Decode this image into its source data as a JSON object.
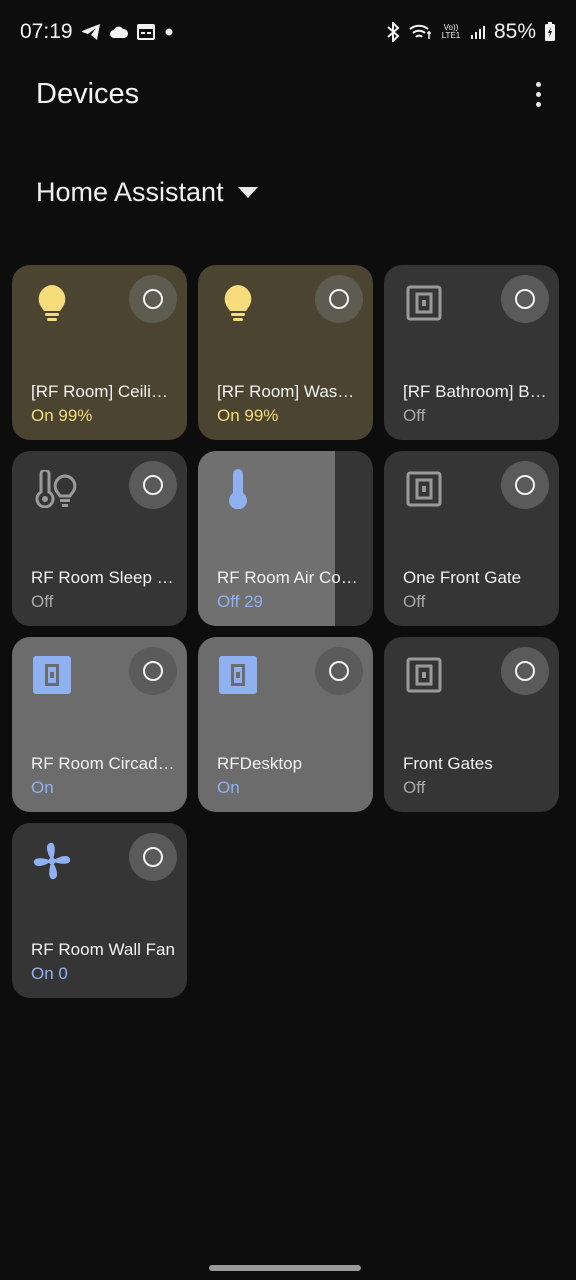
{
  "status_bar": {
    "time": "07:19",
    "battery": "85%",
    "left_icons": [
      "telegram-icon",
      "cloud-icon",
      "calendar-icon",
      "dot-icon"
    ],
    "right_icons": [
      "bluetooth-icon",
      "wifi-icon",
      "volte-icon",
      "signal-icon",
      "battery-icon"
    ],
    "volte_label": "Vo)) LTE1"
  },
  "header": {
    "title": "Devices",
    "menu_icon": "more-vert-icon"
  },
  "selector": {
    "label": "Home Assistant"
  },
  "colors": {
    "on_yellow": "#f7dc7c",
    "on_blue": "#8fb1f1",
    "off_gray": "#a9a9a9"
  },
  "tiles": [
    {
      "name": "[RF Room] Ceilin…",
      "state": "On 99%",
      "icon": "lightbulb-icon"
    },
    {
      "name": "[RF Room] Wash…",
      "state": "On 99%",
      "icon": "lightbulb-icon"
    },
    {
      "name": "[RF Bathroom] B…",
      "state": "Off",
      "icon": "switch-icon"
    },
    {
      "name": "RF Room Sleep …",
      "state": "Off",
      "icon": "thermometer-bulb-icon"
    },
    {
      "name": "RF Room Air Con…",
      "state": "Off 29",
      "icon": "thermometer-icon",
      "level": 0.78
    },
    {
      "name": "One Front Gate",
      "state": "Off",
      "icon": "switch-icon"
    },
    {
      "name": "RF Room Circadi…",
      "state": "On",
      "icon": "switch-icon"
    },
    {
      "name": "RFDesktop",
      "state": "On",
      "icon": "switch-icon"
    },
    {
      "name": "Front Gates",
      "state": "Off",
      "icon": "switch-icon"
    },
    {
      "name": "RF Room Wall Fan",
      "state": "On 0",
      "icon": "fan-icon"
    }
  ]
}
